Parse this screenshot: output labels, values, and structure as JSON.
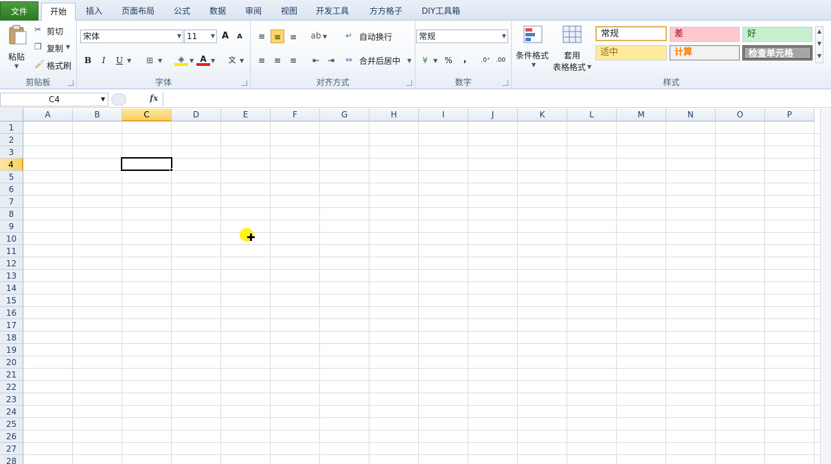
{
  "tabs": [
    "文件",
    "开始",
    "插入",
    "页面布局",
    "公式",
    "数据",
    "审阅",
    "视图",
    "开发工具",
    "方方格子",
    "DIY工具箱"
  ],
  "clipboard": {
    "paste": "粘贴",
    "cut": "剪切",
    "copy": "复制",
    "format_painter": "格式刷",
    "label": "剪贴板"
  },
  "font": {
    "name": "宋体",
    "size": "11",
    "grow": "A",
    "shrink": "A",
    "bold": "B",
    "italic": "I",
    "underline": "U",
    "label": "字体"
  },
  "alignment": {
    "wrap_text": "自动换行",
    "merge_center": "合并后居中",
    "label": "对齐方式"
  },
  "number": {
    "format": "常规",
    "percent": "%",
    "comma": ",",
    "label": "数字"
  },
  "styles": {
    "conditional_format": "条件格式",
    "table_format_1": "套用",
    "table_format_2": "表格格式",
    "cells": [
      "常规",
      "差",
      "好",
      "适中",
      "计算",
      "检查单元格"
    ],
    "label": "样式"
  },
  "formula_bar": {
    "name_box": "C4",
    "fx": "fx",
    "value": ""
  },
  "columns": [
    "A",
    "B",
    "C",
    "D",
    "E",
    "F",
    "G",
    "H",
    "I",
    "J",
    "K",
    "L",
    "M",
    "N",
    "O",
    "P"
  ],
  "rows": [
    "1",
    "2",
    "3",
    "4",
    "5",
    "6",
    "7",
    "8",
    "9",
    "10",
    "11",
    "12",
    "13",
    "14",
    "15",
    "16",
    "17",
    "18",
    "19",
    "20",
    "21",
    "22",
    "23",
    "24",
    "25",
    "26",
    "27",
    "28"
  ],
  "selected_column": "C",
  "selected_row": "4",
  "colors": {
    "file_tab": "#2c7a22",
    "selection_header": "#f9cf5f",
    "cursor_highlight": "#fff200"
  }
}
